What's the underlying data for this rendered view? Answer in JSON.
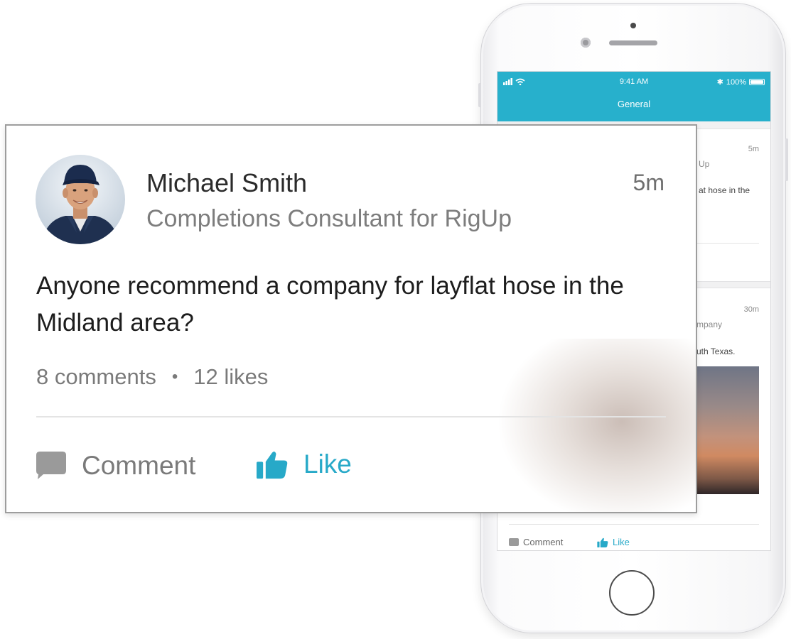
{
  "phone": {
    "status_time": "9:41 AM",
    "battery": "100%",
    "screen_title": "General",
    "posts": [
      {
        "time": "5m",
        "subtitle_fragment": "Up",
        "body_fragment": "at hose in the"
      },
      {
        "time": "30m",
        "subtitle_fragment": "mpany",
        "body_fragment": "uth Texas."
      }
    ],
    "actions": {
      "comment_label": "Comment",
      "like_label": "Like"
    }
  },
  "card": {
    "author_name": "Michael Smith",
    "author_title": "Completions Consultant for RigUp",
    "time": "5m",
    "body": "Anyone recommend a company for layflat hose in the Midland area?",
    "comments": "8 comments",
    "separator": "•",
    "likes": "12 likes",
    "actions": {
      "comment_label": "Comment",
      "like_label": "Like"
    },
    "colors": {
      "accent": "#27a9c8",
      "muted": "#7a7a7a"
    }
  },
  "icons": [
    "comment-icon",
    "thumbs-up-icon",
    "wifi-icon",
    "bluetooth-icon",
    "battery-icon"
  ]
}
